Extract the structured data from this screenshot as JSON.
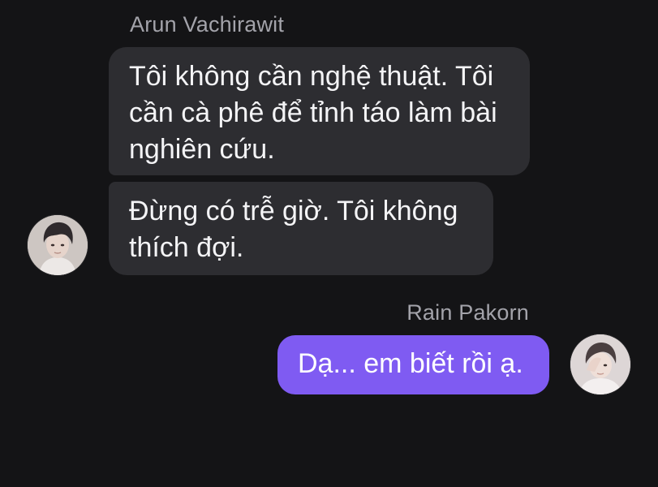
{
  "messages": [
    {
      "sender": "Arun Vachirawit",
      "direction": "incoming",
      "texts": [
        "Tôi không cần nghệ thuật. Tôi cần cà phê để tỉnh táo làm bài nghiên cứu.",
        "Đừng có trễ giờ. Tôi không thích đợi."
      ],
      "avatar_icon": "person-avatar-icon"
    },
    {
      "sender": "Rain Pakorn",
      "direction": "outgoing",
      "texts": [
        "Dạ... em biết rồi ạ."
      ],
      "avatar_icon": "person-avatar-icon"
    }
  ],
  "colors": {
    "background": "#141416",
    "incoming_bubble": "#2d2d31",
    "outgoing_bubble": "#7f5bf2",
    "sender_name": "#a3a3aa"
  }
}
